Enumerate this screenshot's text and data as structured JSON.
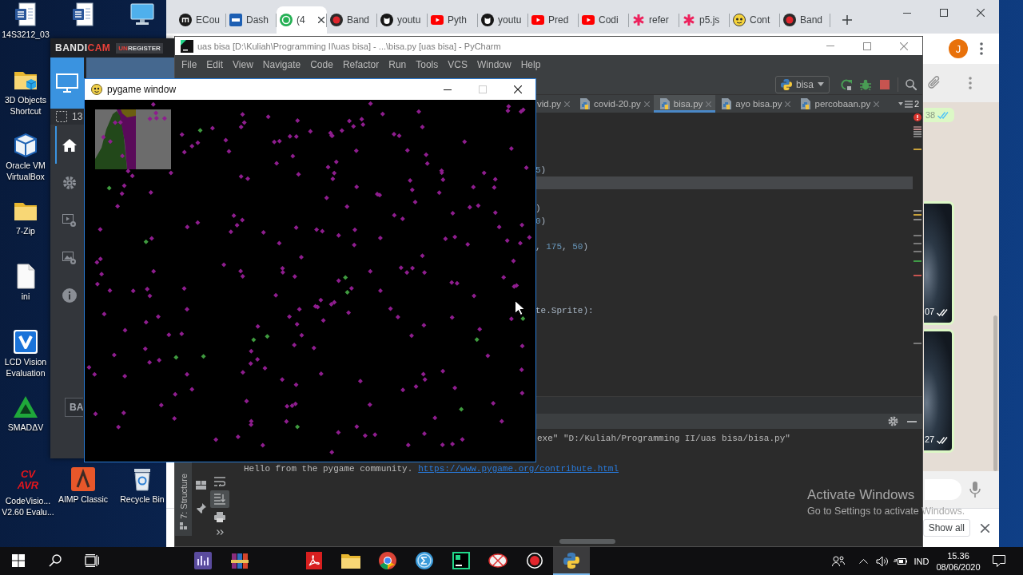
{
  "desktop": {
    "top_row": [
      {
        "kind": "document",
        "label": "14S3212_03"
      },
      {
        "kind": "document"
      },
      {
        "kind": "computer"
      }
    ],
    "left_column": [
      {
        "kind": "folder_cube",
        "label": "3D Objects Shortcut"
      },
      {
        "kind": "cube",
        "label": "Oracle VM VirtualBox"
      },
      {
        "kind": "folder",
        "label": "7-Zip"
      },
      {
        "kind": "file",
        "label": "ini"
      },
      {
        "kind": "v_tile",
        "label": "LCD Vision Evaluation"
      },
      {
        "kind": "triangle",
        "label": "SMADΔV"
      }
    ],
    "bottom_row": [
      {
        "kind": "logo_text",
        "logo": [
          "CV",
          "AVR"
        ],
        "label": "CodeVisio... V2.60 Evalu..."
      },
      {
        "kind": "a_tile",
        "label": "AIMP Classic"
      },
      {
        "kind": "bin",
        "label": "Recycle Bin"
      }
    ]
  },
  "bandicam": {
    "logo": {
      "main": "BANDI",
      "accent": "CAM"
    },
    "badge": {
      "accent": "UN",
      "rest": "REGISTER"
    },
    "modes": [
      {
        "kind": "screen",
        "selected": true
      },
      {
        "kind": "game",
        "selected": false
      }
    ],
    "capture_size": "13",
    "nav": [
      {
        "kind": "home",
        "selected": true
      },
      {
        "kind": "gear",
        "selected": false
      },
      {
        "kind": "video_gear",
        "selected": false
      },
      {
        "kind": "image_gear",
        "selected": false
      },
      {
        "kind": "info",
        "selected": false
      }
    ],
    "footer_button": "BA"
  },
  "browser": {
    "tabs": [
      {
        "title": "ECou",
        "kind": "m_circle",
        "selected": false
      },
      {
        "title": "Dash",
        "kind": "del",
        "selected": false
      },
      {
        "title": "(4",
        "kind": "chat",
        "selected": true
      },
      {
        "title": "Band",
        "kind": "record",
        "selected": false
      },
      {
        "title": "youtu",
        "kind": "octocat",
        "selected": false
      },
      {
        "title": "Pyth",
        "kind": "play",
        "selected": false
      },
      {
        "title": "youtu",
        "kind": "octocat",
        "selected": false
      },
      {
        "title": "Pred",
        "kind": "play",
        "selected": false
      },
      {
        "title": "Codi",
        "kind": "play",
        "selected": false
      },
      {
        "title": "refer",
        "kind": "asterisk",
        "selected": false
      },
      {
        "title": "p5.js",
        "kind": "asterisk",
        "selected": false
      },
      {
        "title": "Cont",
        "kind": "face",
        "selected": false
      },
      {
        "title": "Band",
        "kind": "record",
        "selected": false
      }
    ],
    "avatar": "J",
    "chat": {
      "bubbles": [
        {
          "kind": "text",
          "time": "38"
        },
        {
          "kind": "image",
          "time": "07"
        },
        {
          "kind": "image",
          "time": "27"
        }
      ]
    },
    "download_bar": {
      "button": "Show all"
    }
  },
  "ide": {
    "title": "uas bisa [D:\\Kuliah\\Programming II\\uas bisa] - ...\\bisa.py [uas bisa] - PyCharm",
    "menu": [
      "File",
      "Edit",
      "View",
      "Navigate",
      "Code",
      "Refactor",
      "Run",
      "Tools",
      "VCS",
      "Window",
      "Help"
    ],
    "run_config": "bisa",
    "editor_tabs": [
      {
        "label": "vid.py",
        "kind": "clipped",
        "selected": false
      },
      {
        "label": "covid-20.py",
        "kind": "python",
        "selected": false
      },
      {
        "label": "bisa.py",
        "kind": "python",
        "selected": true
      },
      {
        "label": "ayo bisa.py",
        "kind": "python",
        "selected": false
      },
      {
        "label": "percobaan.py",
        "kind": "python",
        "selected": false
      }
    ],
    "tab_overflow_count": "2",
    "code_lines": [
      {
        "text": "5)",
        "current": false
      },
      {
        "current": true
      },
      {
        "current": false
      },
      {
        "text": ")",
        "current": false
      },
      {
        "text": "0)",
        "current": false
      },
      {
        "current": false
      },
      {
        "text": ", 175, 50)",
        "current": false
      },
      {
        "current": false
      },
      {
        "current": false
      },
      {
        "current": false
      },
      {
        "current": false
      },
      {
        "text": "te.Sprite):",
        "current": false
      }
    ],
    "side_tab": "7: Structure",
    "console_tools": [
      {
        "kind": "soft_wrap",
        "on": false
      },
      {
        "kind": "scroll_end",
        "on": true
      },
      {
        "kind": "print",
        "on": false
      }
    ],
    "console_lines": [
      {
        "kind": "command",
        "text": "exe\" \"D:/Kuliah/Programming II/uas bisa/bisa.py\""
      },
      {
        "kind": "output",
        "text": "Hello from the pygame community.",
        "link": "https://www.pygame.org/contribute.html"
      }
    ]
  },
  "game": {
    "title": "pygame window",
    "maximize_disabled": true
  },
  "activation": {
    "title": "Activate Windows",
    "subtitle": "Go to Settings to activate Windows."
  },
  "taskbar": {
    "apps": [
      {
        "kind": "equalizer",
        "selected": false
      },
      {
        "kind": "books",
        "selected": false
      },
      {
        "kind": "pdf",
        "selected": false
      },
      {
        "kind": "folder",
        "selected": false
      },
      {
        "kind": "browser",
        "selected": false
      },
      {
        "kind": "sigma",
        "selected": false
      },
      {
        "kind": "ide",
        "selected": false
      },
      {
        "kind": "scissors",
        "selected": false
      },
      {
        "kind": "record",
        "selected": false
      },
      {
        "kind": "snake",
        "selected": true
      }
    ],
    "language": "IND",
    "time": "15.36",
    "date": "08/06/2020"
  }
}
